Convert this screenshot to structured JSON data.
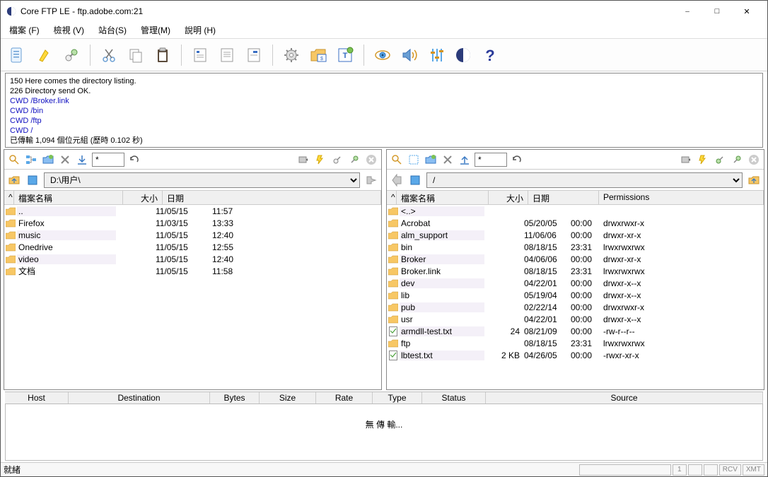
{
  "window": {
    "title": "Core FTP LE - ftp.adobe.com:21"
  },
  "menu": {
    "file": "檔案 (F)",
    "view": "檢視 (V)",
    "sites": "站台(S)",
    "manage": "管理(M)",
    "help": "說明 (H)"
  },
  "log": {
    "l1": "150 Here comes the directory listing.",
    "l2": "226 Directory send OK.",
    "c1": "CWD /Broker.link",
    "c2": "CWD /bin",
    "c3": "CWD /ftp",
    "c4": "CWD /",
    "l3": "已傳輸 1,094 個位元組 (歷時 0.102 秒)"
  },
  "local": {
    "filter": "*",
    "path": "D:\\用户\\",
    "cols": {
      "name": "檔案名稱",
      "size": "大小",
      "date": "日期"
    },
    "rows": [
      {
        "icon": "folder",
        "name": "..",
        "size": "",
        "date": "11/05/15",
        "time": "11:57"
      },
      {
        "icon": "folder",
        "name": "Firefox",
        "size": "",
        "date": "11/03/15",
        "time": "13:33"
      },
      {
        "icon": "folder",
        "name": "music",
        "size": "",
        "date": "11/05/15",
        "time": "12:40"
      },
      {
        "icon": "folder",
        "name": "Onedrive",
        "size": "",
        "date": "11/05/15",
        "time": "12:55"
      },
      {
        "icon": "folder",
        "name": "video",
        "size": "",
        "date": "11/05/15",
        "time": "12:40"
      },
      {
        "icon": "folder",
        "name": "文档",
        "size": "",
        "date": "11/05/15",
        "time": "11:58"
      }
    ]
  },
  "remote": {
    "filter": "*",
    "path": "/",
    "cols": {
      "name": "檔案名稱",
      "size": "大小",
      "date": "日期",
      "perm": "Permissions"
    },
    "rows": [
      {
        "icon": "folder",
        "name": "<..>",
        "size": "",
        "date": "",
        "time": "",
        "perm": ""
      },
      {
        "icon": "folder",
        "name": "Acrobat",
        "size": "",
        "date": "05/20/05",
        "time": "00:00",
        "perm": "drwxrwxr-x"
      },
      {
        "icon": "folder",
        "name": "alm_support",
        "size": "",
        "date": "11/06/06",
        "time": "00:00",
        "perm": "drwxr-xr-x"
      },
      {
        "icon": "folder",
        "name": "bin",
        "size": "",
        "date": "08/18/15",
        "time": "23:31",
        "perm": "lrwxrwxrwx"
      },
      {
        "icon": "folder",
        "name": "Broker",
        "size": "",
        "date": "04/06/06",
        "time": "00:00",
        "perm": "drwxr-xr-x"
      },
      {
        "icon": "folder",
        "name": "Broker.link",
        "size": "",
        "date": "08/18/15",
        "time": "23:31",
        "perm": "lrwxrwxrwx"
      },
      {
        "icon": "folder",
        "name": "dev",
        "size": "",
        "date": "04/22/01",
        "time": "00:00",
        "perm": "drwxr-x--x"
      },
      {
        "icon": "folder",
        "name": "lib",
        "size": "",
        "date": "05/19/04",
        "time": "00:00",
        "perm": "drwxr-x--x"
      },
      {
        "icon": "folder",
        "name": "pub",
        "size": "",
        "date": "02/22/14",
        "time": "00:00",
        "perm": "drwxrwxr-x"
      },
      {
        "icon": "folder",
        "name": "usr",
        "size": "",
        "date": "04/22/01",
        "time": "00:00",
        "perm": "drwxr-x--x"
      },
      {
        "icon": "file",
        "name": "armdll-test.txt",
        "size": "24",
        "date": "08/21/09",
        "time": "00:00",
        "perm": "-rw-r--r--"
      },
      {
        "icon": "folder",
        "name": "ftp",
        "size": "",
        "date": "08/18/15",
        "time": "23:31",
        "perm": "lrwxrwxrwx"
      },
      {
        "icon": "file",
        "name": "lbtest.txt",
        "size": "2 KB",
        "date": "04/26/05",
        "time": "00:00",
        "perm": "-rwxr-xr-x"
      }
    ]
  },
  "transfer": {
    "cols": {
      "host": "Host",
      "dest": "Destination",
      "bytes": "Bytes",
      "size": "Size",
      "rate": "Rate",
      "type": "Type",
      "status": "Status",
      "source": "Source"
    },
    "empty": "無 傳 輸..."
  },
  "status": {
    "ready": "就緒",
    "num": "1",
    "rcv": "RCV",
    "xmt": "XMT"
  }
}
